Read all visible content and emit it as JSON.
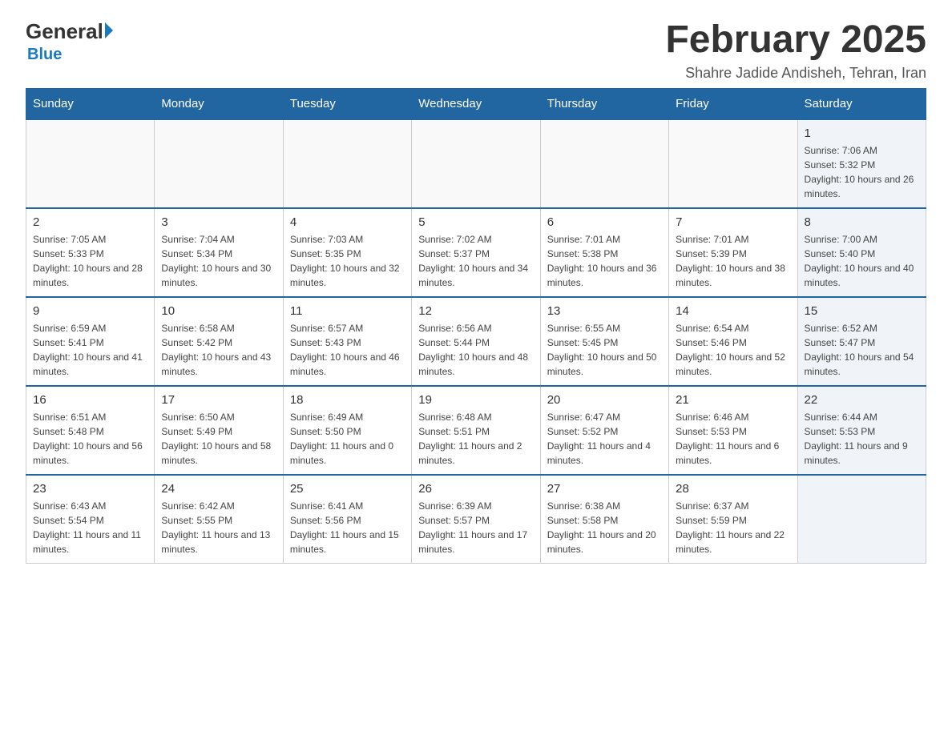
{
  "header": {
    "logo_general": "General",
    "logo_blue": "Blue",
    "title": "February 2025",
    "subtitle": "Shahre Jadide Andisheh, Tehran, Iran"
  },
  "weekdays": [
    "Sunday",
    "Monday",
    "Tuesday",
    "Wednesday",
    "Thursday",
    "Friday",
    "Saturday"
  ],
  "weeks": [
    [
      {
        "day": "",
        "info": ""
      },
      {
        "day": "",
        "info": ""
      },
      {
        "day": "",
        "info": ""
      },
      {
        "day": "",
        "info": ""
      },
      {
        "day": "",
        "info": ""
      },
      {
        "day": "",
        "info": ""
      },
      {
        "day": "1",
        "info": "Sunrise: 7:06 AM\nSunset: 5:32 PM\nDaylight: 10 hours and 26 minutes."
      }
    ],
    [
      {
        "day": "2",
        "info": "Sunrise: 7:05 AM\nSunset: 5:33 PM\nDaylight: 10 hours and 28 minutes."
      },
      {
        "day": "3",
        "info": "Sunrise: 7:04 AM\nSunset: 5:34 PM\nDaylight: 10 hours and 30 minutes."
      },
      {
        "day": "4",
        "info": "Sunrise: 7:03 AM\nSunset: 5:35 PM\nDaylight: 10 hours and 32 minutes."
      },
      {
        "day": "5",
        "info": "Sunrise: 7:02 AM\nSunset: 5:37 PM\nDaylight: 10 hours and 34 minutes."
      },
      {
        "day": "6",
        "info": "Sunrise: 7:01 AM\nSunset: 5:38 PM\nDaylight: 10 hours and 36 minutes."
      },
      {
        "day": "7",
        "info": "Sunrise: 7:01 AM\nSunset: 5:39 PM\nDaylight: 10 hours and 38 minutes."
      },
      {
        "day": "8",
        "info": "Sunrise: 7:00 AM\nSunset: 5:40 PM\nDaylight: 10 hours and 40 minutes."
      }
    ],
    [
      {
        "day": "9",
        "info": "Sunrise: 6:59 AM\nSunset: 5:41 PM\nDaylight: 10 hours and 41 minutes."
      },
      {
        "day": "10",
        "info": "Sunrise: 6:58 AM\nSunset: 5:42 PM\nDaylight: 10 hours and 43 minutes."
      },
      {
        "day": "11",
        "info": "Sunrise: 6:57 AM\nSunset: 5:43 PM\nDaylight: 10 hours and 46 minutes."
      },
      {
        "day": "12",
        "info": "Sunrise: 6:56 AM\nSunset: 5:44 PM\nDaylight: 10 hours and 48 minutes."
      },
      {
        "day": "13",
        "info": "Sunrise: 6:55 AM\nSunset: 5:45 PM\nDaylight: 10 hours and 50 minutes."
      },
      {
        "day": "14",
        "info": "Sunrise: 6:54 AM\nSunset: 5:46 PM\nDaylight: 10 hours and 52 minutes."
      },
      {
        "day": "15",
        "info": "Sunrise: 6:52 AM\nSunset: 5:47 PM\nDaylight: 10 hours and 54 minutes."
      }
    ],
    [
      {
        "day": "16",
        "info": "Sunrise: 6:51 AM\nSunset: 5:48 PM\nDaylight: 10 hours and 56 minutes."
      },
      {
        "day": "17",
        "info": "Sunrise: 6:50 AM\nSunset: 5:49 PM\nDaylight: 10 hours and 58 minutes."
      },
      {
        "day": "18",
        "info": "Sunrise: 6:49 AM\nSunset: 5:50 PM\nDaylight: 11 hours and 0 minutes."
      },
      {
        "day": "19",
        "info": "Sunrise: 6:48 AM\nSunset: 5:51 PM\nDaylight: 11 hours and 2 minutes."
      },
      {
        "day": "20",
        "info": "Sunrise: 6:47 AM\nSunset: 5:52 PM\nDaylight: 11 hours and 4 minutes."
      },
      {
        "day": "21",
        "info": "Sunrise: 6:46 AM\nSunset: 5:53 PM\nDaylight: 11 hours and 6 minutes."
      },
      {
        "day": "22",
        "info": "Sunrise: 6:44 AM\nSunset: 5:53 PM\nDaylight: 11 hours and 9 minutes."
      }
    ],
    [
      {
        "day": "23",
        "info": "Sunrise: 6:43 AM\nSunset: 5:54 PM\nDaylight: 11 hours and 11 minutes."
      },
      {
        "day": "24",
        "info": "Sunrise: 6:42 AM\nSunset: 5:55 PM\nDaylight: 11 hours and 13 minutes."
      },
      {
        "day": "25",
        "info": "Sunrise: 6:41 AM\nSunset: 5:56 PM\nDaylight: 11 hours and 15 minutes."
      },
      {
        "day": "26",
        "info": "Sunrise: 6:39 AM\nSunset: 5:57 PM\nDaylight: 11 hours and 17 minutes."
      },
      {
        "day": "27",
        "info": "Sunrise: 6:38 AM\nSunset: 5:58 PM\nDaylight: 11 hours and 20 minutes."
      },
      {
        "day": "28",
        "info": "Sunrise: 6:37 AM\nSunset: 5:59 PM\nDaylight: 11 hours and 22 minutes."
      },
      {
        "day": "",
        "info": ""
      }
    ]
  ]
}
